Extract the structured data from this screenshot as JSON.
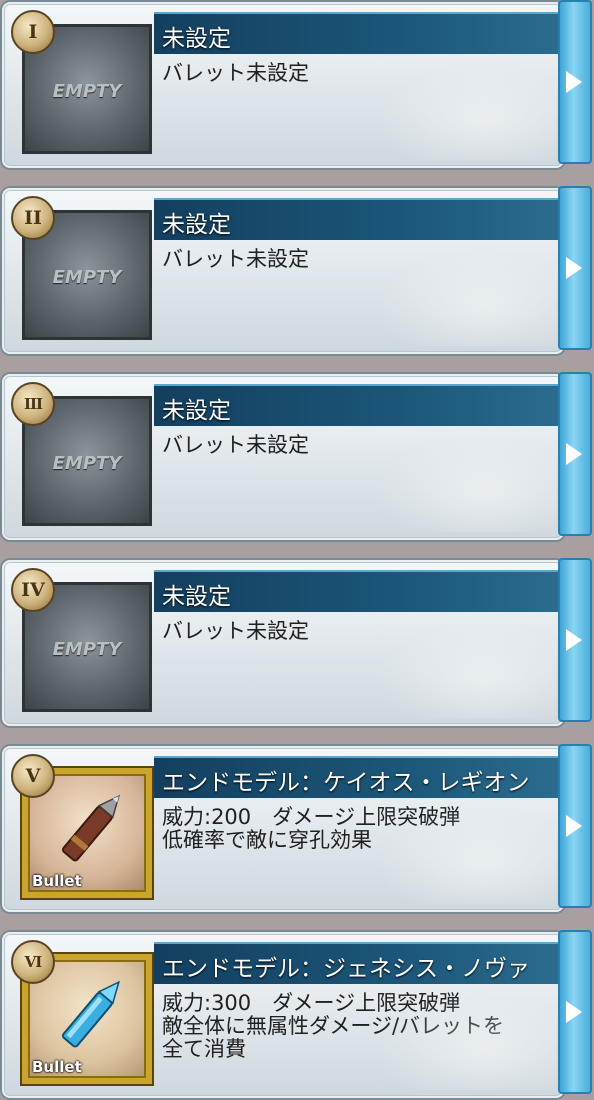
{
  "slots": [
    {
      "numeral": "I",
      "title": "未設定",
      "desc": [
        "バレット未設定"
      ],
      "thumb": "EMPTY"
    },
    {
      "numeral": "II",
      "title": "未設定",
      "desc": [
        "バレット未設定"
      ],
      "thumb": "EMPTY"
    },
    {
      "numeral": "III",
      "title": "未設定",
      "desc": [
        "バレット未設定"
      ],
      "thumb": "EMPTY"
    },
    {
      "numeral": "IV",
      "title": "未設定",
      "desc": [
        "バレット未設定"
      ],
      "thumb": "EMPTY"
    },
    {
      "numeral": "V",
      "title": "エンドモデル：ケイオス・レギオン",
      "desc": [
        "威力:200　ダメージ上限突破弾",
        "低確率で敵に穿孔効果"
      ],
      "thumb": "Bullet"
    },
    {
      "numeral": "VI",
      "title": "エンドモデル：ジェネシス・ノヴァ",
      "desc": [
        "威力:300　ダメージ上限突破弾",
        "敵全体に無属性ダメージ/バレットを",
        "全て消費"
      ],
      "thumb": "Bullet"
    }
  ],
  "icons": {
    "arrow": "chevron-right-icon",
    "bullet": "bullet-icon"
  }
}
